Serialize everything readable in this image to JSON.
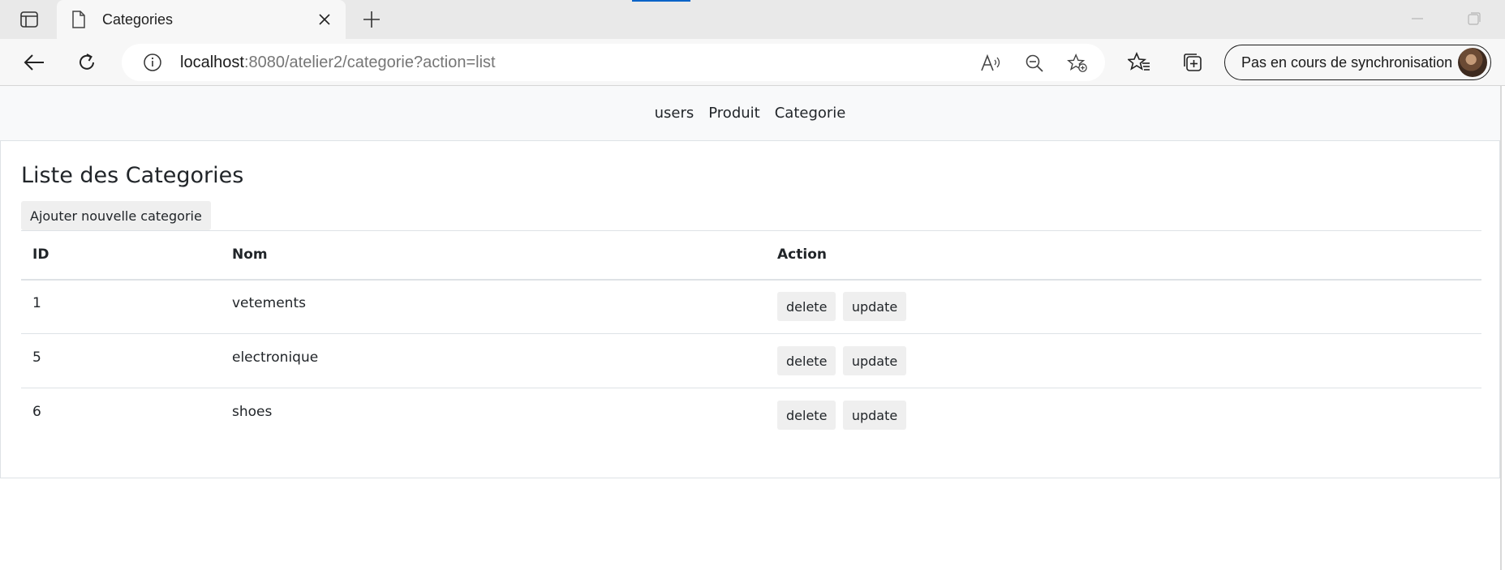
{
  "browser": {
    "tab_title": "Categories",
    "url_host": "localhost",
    "url_rest": ":8080/atelier2/categorie?action=list",
    "profile_label": "Pas en cours de synchronisation"
  },
  "nav": {
    "links": [
      "users",
      "Produit",
      "Categorie"
    ]
  },
  "main": {
    "title": "Liste des Categories",
    "add_button": "Ajouter nouvelle categorie",
    "table": {
      "headers": [
        "ID",
        "Nom",
        "Action"
      ],
      "rows": [
        {
          "id": "1",
          "nom": "vetements",
          "delete": "delete",
          "update": "update"
        },
        {
          "id": "5",
          "nom": "electronique",
          "delete": "delete",
          "update": "update"
        },
        {
          "id": "6",
          "nom": "shoes",
          "delete": "delete",
          "update": "update"
        }
      ]
    }
  },
  "colors": {
    "accent_loading": "#0a64c8",
    "navbar_bg": "#f8f9fa",
    "button_bg": "#efefef"
  }
}
